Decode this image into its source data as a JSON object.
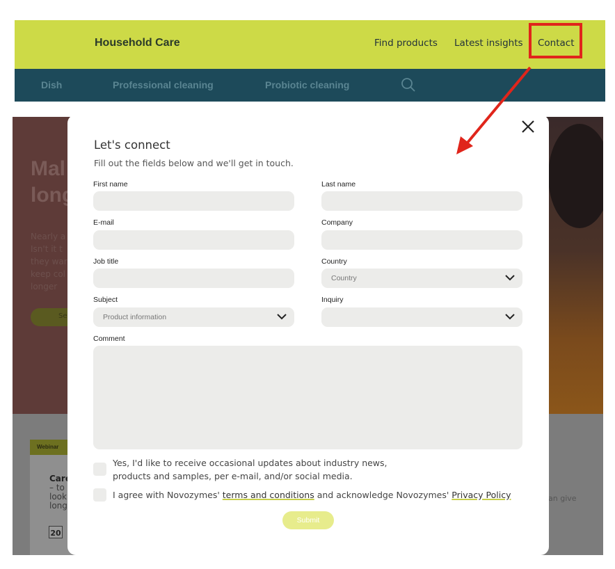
{
  "header": {
    "brand": "Household Care",
    "nav": [
      "Find products",
      "Latest insights",
      "Contact"
    ]
  },
  "subnav": {
    "items": [
      "Dish",
      "Professional cleaning",
      "Probiotic cleaning"
    ],
    "search_icon": "search-icon"
  },
  "hero": {
    "title_lines": [
      "Mal",
      "long"
    ],
    "text_lines": [
      "Nearly a",
      "Isn't it t",
      "they war",
      "keep col",
      "longer"
    ],
    "button_label": "Se"
  },
  "lower": {
    "card_tag": "Webinar",
    "card_lines": [
      "Care",
      "– to",
      "look",
      "long"
    ],
    "date": "20",
    "side_text": "an give"
  },
  "modal": {
    "title": "Let's connect",
    "subtitle": "Fill out the fields below and we'll get in touch.",
    "fields": {
      "first_name": "First name",
      "last_name": "Last name",
      "email": "E-mail",
      "company": "Company",
      "job_title": "Job title",
      "country": "Country",
      "subject": "Subject",
      "inquiry": "Inquiry",
      "comment": "Comment"
    },
    "selects": {
      "country_value": "Country",
      "subject_value": "Product information",
      "inquiry_value": ""
    },
    "checkbox_updates_line1": "Yes, I'd like to receive occasional updates about industry news,",
    "checkbox_updates_line2": "products and samples, per e-mail, and/or social media.",
    "checkbox_terms_prefix": "I agree with Novozymes' ",
    "terms_link": "terms and conditions",
    "checkbox_terms_middle": " and acknowledge Novozymes' ",
    "privacy_link": "Privacy Policy",
    "submit_label": "Submit",
    "close_icon": "close-icon"
  },
  "colors": {
    "topbar": "#cdda47",
    "subbar": "#1d4a5a",
    "annotation": "#e0251b",
    "submit": "#e7ec8c"
  }
}
